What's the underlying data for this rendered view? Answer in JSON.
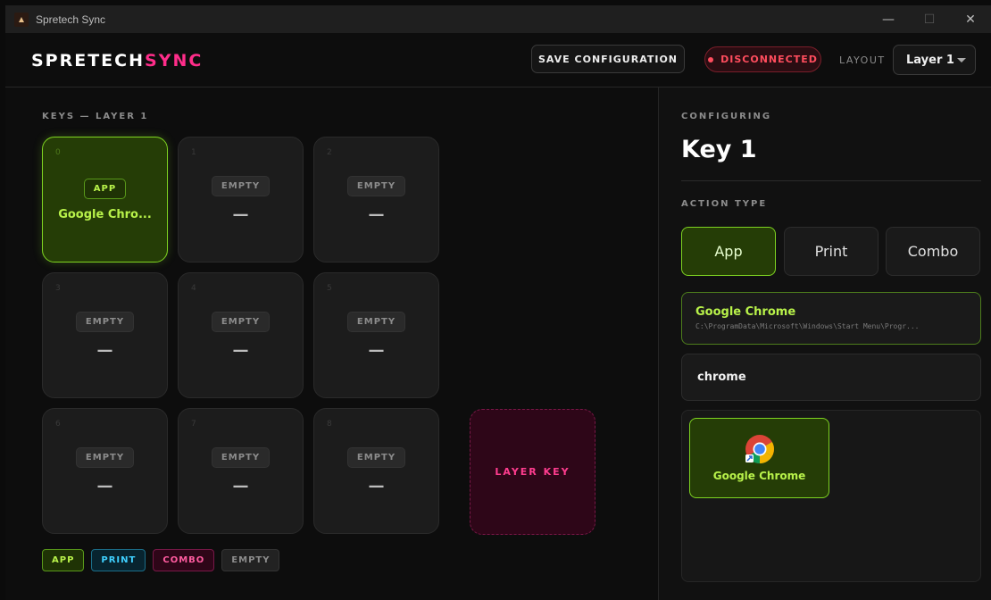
{
  "window": {
    "title": "Spretech Sync",
    "minimize": "—",
    "maximize": "☐",
    "close": "✕"
  },
  "brand": {
    "part1": "SPRETECH",
    "part2": "SYNC"
  },
  "header": {
    "save_label": "SAVE CONFIGURATION",
    "status_label": "DISCONNECTED",
    "layout_label": "LAYOUT",
    "layout_value": "Layer 1"
  },
  "keys_section": {
    "label": "KEYS — LAYER 1"
  },
  "keys": [
    {
      "num": "0",
      "tag": "APP",
      "value": "Google Chro...",
      "type": "app"
    },
    {
      "num": "1",
      "tag": "EMPTY",
      "value": "—",
      "type": "empty"
    },
    {
      "num": "2",
      "tag": "EMPTY",
      "value": "—",
      "type": "empty"
    },
    {
      "num": "3",
      "tag": "EMPTY",
      "value": "—",
      "type": "empty"
    },
    {
      "num": "4",
      "tag": "EMPTY",
      "value": "—",
      "type": "empty"
    },
    {
      "num": "5",
      "tag": "EMPTY",
      "value": "—",
      "type": "empty"
    },
    {
      "num": "6",
      "tag": "EMPTY",
      "value": "—",
      "type": "empty"
    },
    {
      "num": "7",
      "tag": "EMPTY",
      "value": "—",
      "type": "empty"
    },
    {
      "num": "8",
      "tag": "EMPTY",
      "value": "—",
      "type": "empty"
    }
  ],
  "layer_key": {
    "label": "LAYER KEY"
  },
  "legend": {
    "app": "APP",
    "print": "PRINT",
    "combo": "COMBO",
    "empty": "EMPTY"
  },
  "config": {
    "label": "CONFIGURING",
    "key_name": "Key 1",
    "action_type_label": "ACTION TYPE",
    "action_types": [
      "App",
      "Print",
      "Combo"
    ],
    "selected_action": "App",
    "selected_app": {
      "name": "Google Chrome",
      "path": "C:\\ProgramData\\Microsoft\\Windows\\Start Menu\\Progr..."
    },
    "search_value": "chrome",
    "results": [
      {
        "label": "Google Chrome",
        "icon": "chrome-icon"
      }
    ]
  },
  "colors": {
    "accent_pink": "#ff2d8a",
    "app_green": "#7ed321",
    "print_cyan": "#3fd0ff",
    "status_red": "#ff4d5e"
  }
}
